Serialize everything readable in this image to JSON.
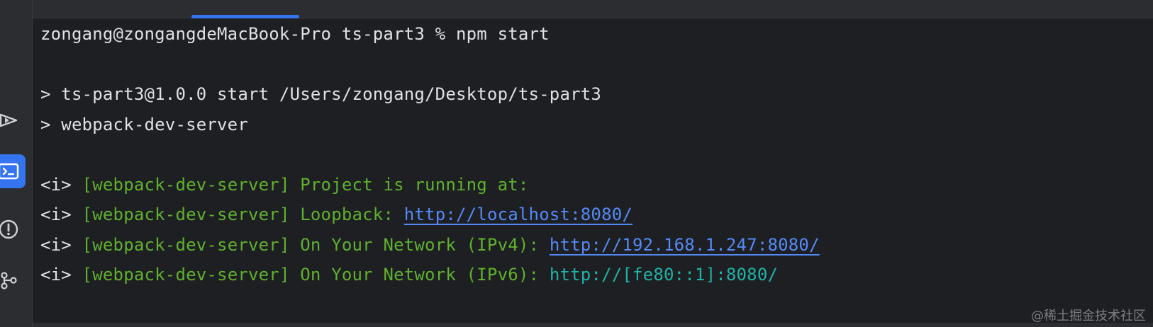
{
  "sidebar": {
    "items": [
      {
        "icon": "run-debug-icon",
        "active": false
      },
      {
        "icon": "terminal-icon",
        "active": true
      },
      {
        "icon": "problems-icon",
        "active": false
      },
      {
        "icon": "git-icon",
        "active": false
      }
    ]
  },
  "terminal": {
    "prompt": "zongang@zongangdeMacBook-Pro ts-part3 % npm start",
    "script_line1": "> ts-part3@1.0.0 start /Users/zongang/Desktop/ts-part3",
    "script_line2": "> webpack-dev-server",
    "info_prefix": "<i>",
    "tag": "[webpack-dev-server]",
    "msg_running": "Project is running at:",
    "msg_loopback": "Loopback:",
    "url_loopback": "http://localhost:8080/",
    "msg_ipv4": "On Your Network (IPv4):",
    "url_ipv4": "http://192.168.1.247:8080/",
    "msg_ipv6": "On Your Network (IPv6):",
    "url_ipv6": "http://[fe80::1]:8080/"
  },
  "watermark": "@稀土掘金技术社区",
  "colors": {
    "background": "#1e1f22",
    "text": "#dfe1e5",
    "green": "#5fb12e",
    "link": "#548af7",
    "cyan": "#1fb3a8",
    "accent": "#3574f0"
  }
}
